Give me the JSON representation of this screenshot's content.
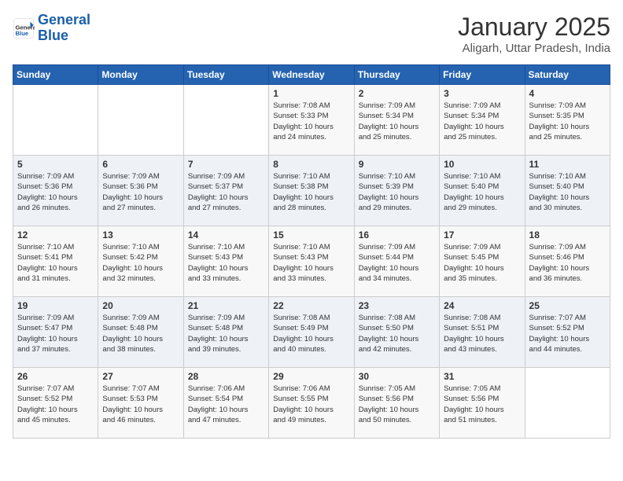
{
  "logo": {
    "general": "General",
    "blue": "Blue"
  },
  "header": {
    "title": "January 2025",
    "subtitle": "Aligarh, Uttar Pradesh, India"
  },
  "weekdays": [
    "Sunday",
    "Monday",
    "Tuesday",
    "Wednesday",
    "Thursday",
    "Friday",
    "Saturday"
  ],
  "weeks": [
    [
      {
        "day": "",
        "info": ""
      },
      {
        "day": "",
        "info": ""
      },
      {
        "day": "",
        "info": ""
      },
      {
        "day": "1",
        "info": "Sunrise: 7:08 AM\nSunset: 5:33 PM\nDaylight: 10 hours\nand 24 minutes."
      },
      {
        "day": "2",
        "info": "Sunrise: 7:09 AM\nSunset: 5:34 PM\nDaylight: 10 hours\nand 25 minutes."
      },
      {
        "day": "3",
        "info": "Sunrise: 7:09 AM\nSunset: 5:34 PM\nDaylight: 10 hours\nand 25 minutes."
      },
      {
        "day": "4",
        "info": "Sunrise: 7:09 AM\nSunset: 5:35 PM\nDaylight: 10 hours\nand 25 minutes."
      }
    ],
    [
      {
        "day": "5",
        "info": "Sunrise: 7:09 AM\nSunset: 5:36 PM\nDaylight: 10 hours\nand 26 minutes."
      },
      {
        "day": "6",
        "info": "Sunrise: 7:09 AM\nSunset: 5:36 PM\nDaylight: 10 hours\nand 27 minutes."
      },
      {
        "day": "7",
        "info": "Sunrise: 7:09 AM\nSunset: 5:37 PM\nDaylight: 10 hours\nand 27 minutes."
      },
      {
        "day": "8",
        "info": "Sunrise: 7:10 AM\nSunset: 5:38 PM\nDaylight: 10 hours\nand 28 minutes."
      },
      {
        "day": "9",
        "info": "Sunrise: 7:10 AM\nSunset: 5:39 PM\nDaylight: 10 hours\nand 29 minutes."
      },
      {
        "day": "10",
        "info": "Sunrise: 7:10 AM\nSunset: 5:40 PM\nDaylight: 10 hours\nand 29 minutes."
      },
      {
        "day": "11",
        "info": "Sunrise: 7:10 AM\nSunset: 5:40 PM\nDaylight: 10 hours\nand 30 minutes."
      }
    ],
    [
      {
        "day": "12",
        "info": "Sunrise: 7:10 AM\nSunset: 5:41 PM\nDaylight: 10 hours\nand 31 minutes."
      },
      {
        "day": "13",
        "info": "Sunrise: 7:10 AM\nSunset: 5:42 PM\nDaylight: 10 hours\nand 32 minutes."
      },
      {
        "day": "14",
        "info": "Sunrise: 7:10 AM\nSunset: 5:43 PM\nDaylight: 10 hours\nand 33 minutes."
      },
      {
        "day": "15",
        "info": "Sunrise: 7:10 AM\nSunset: 5:43 PM\nDaylight: 10 hours\nand 33 minutes."
      },
      {
        "day": "16",
        "info": "Sunrise: 7:09 AM\nSunset: 5:44 PM\nDaylight: 10 hours\nand 34 minutes."
      },
      {
        "day": "17",
        "info": "Sunrise: 7:09 AM\nSunset: 5:45 PM\nDaylight: 10 hours\nand 35 minutes."
      },
      {
        "day": "18",
        "info": "Sunrise: 7:09 AM\nSunset: 5:46 PM\nDaylight: 10 hours\nand 36 minutes."
      }
    ],
    [
      {
        "day": "19",
        "info": "Sunrise: 7:09 AM\nSunset: 5:47 PM\nDaylight: 10 hours\nand 37 minutes."
      },
      {
        "day": "20",
        "info": "Sunrise: 7:09 AM\nSunset: 5:48 PM\nDaylight: 10 hours\nand 38 minutes."
      },
      {
        "day": "21",
        "info": "Sunrise: 7:09 AM\nSunset: 5:48 PM\nDaylight: 10 hours\nand 39 minutes."
      },
      {
        "day": "22",
        "info": "Sunrise: 7:08 AM\nSunset: 5:49 PM\nDaylight: 10 hours\nand 40 minutes."
      },
      {
        "day": "23",
        "info": "Sunrise: 7:08 AM\nSunset: 5:50 PM\nDaylight: 10 hours\nand 42 minutes."
      },
      {
        "day": "24",
        "info": "Sunrise: 7:08 AM\nSunset: 5:51 PM\nDaylight: 10 hours\nand 43 minutes."
      },
      {
        "day": "25",
        "info": "Sunrise: 7:07 AM\nSunset: 5:52 PM\nDaylight: 10 hours\nand 44 minutes."
      }
    ],
    [
      {
        "day": "26",
        "info": "Sunrise: 7:07 AM\nSunset: 5:52 PM\nDaylight: 10 hours\nand 45 minutes."
      },
      {
        "day": "27",
        "info": "Sunrise: 7:07 AM\nSunset: 5:53 PM\nDaylight: 10 hours\nand 46 minutes."
      },
      {
        "day": "28",
        "info": "Sunrise: 7:06 AM\nSunset: 5:54 PM\nDaylight: 10 hours\nand 47 minutes."
      },
      {
        "day": "29",
        "info": "Sunrise: 7:06 AM\nSunset: 5:55 PM\nDaylight: 10 hours\nand 49 minutes."
      },
      {
        "day": "30",
        "info": "Sunrise: 7:05 AM\nSunset: 5:56 PM\nDaylight: 10 hours\nand 50 minutes."
      },
      {
        "day": "31",
        "info": "Sunrise: 7:05 AM\nSunset: 5:56 PM\nDaylight: 10 hours\nand 51 minutes."
      },
      {
        "day": "",
        "info": ""
      }
    ]
  ]
}
